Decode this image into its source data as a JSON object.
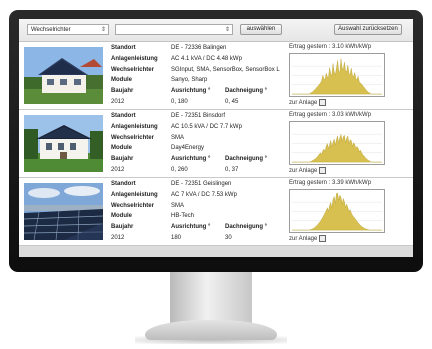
{
  "toolbar": {
    "filter_select": "Wechselrichter",
    "second_select": "",
    "select_button": "auswählen",
    "reset_button": "Auswahl zurücksetzen"
  },
  "labels": {
    "standort": "Standort",
    "anlagenleistung": "Anlagenleistung",
    "wechselrichter": "Wechselrichter",
    "module": "Module",
    "baujahr": "Baujahr",
    "ausrichtung": "Ausrichtung °",
    "dachneigung": "Dachneigung °",
    "zur_anlage": "zur Anlage"
  },
  "plants": [
    {
      "standort": "DE - 72336 Balingen",
      "leistung": "AC 4.1 kVA / DC 4.48 kWp",
      "wechselrichter": "SGInput, SMA, SensorBox, SensorBox L",
      "module": "Sanyo, Sharp",
      "baujahr": "2012",
      "ausrichtung": "0, 180",
      "dachneigung": "0, 45",
      "ertrag": "Ertrag gestern : 3.10 kWh/kWp",
      "chart": [
        0,
        0,
        0,
        0,
        0,
        0,
        0,
        0,
        0,
        0,
        0,
        0,
        0,
        0,
        0,
        0,
        0.02,
        0.04,
        0.06,
        0.09,
        0.12,
        0.15,
        0.19,
        0.22,
        0.26,
        0.3,
        0.35,
        0.5,
        0.42,
        0.38,
        0.56,
        0.47,
        0.44,
        0.71,
        0.55,
        0.49,
        0.82,
        0.6,
        0.52,
        0.69,
        0.9,
        0.62,
        0.58,
        0.95,
        0.7,
        0.66,
        0.86,
        0.62,
        0.6,
        0.78,
        0.55,
        0.52,
        0.7,
        0.5,
        0.46,
        0.58,
        0.42,
        0.38,
        0.48,
        0.33,
        0.3,
        0.27,
        0.23,
        0.19,
        0.15,
        0.11,
        0.08,
        0.05,
        0.03,
        0.01,
        0,
        0,
        0,
        0,
        0,
        0,
        0,
        0,
        0,
        0
      ]
    },
    {
      "standort": "DE - 72351 Binsdorf",
      "leistung": "AC 10.5 kVA / DC 7.7 kWp",
      "wechselrichter": "SMA",
      "module": "Day4Energy",
      "baujahr": "2012",
      "ausrichtung": "0, 260",
      "dachneigung": "0, 37",
      "ertrag": "Ertrag gestern : 3.03 kWh/kWp",
      "chart": [
        0,
        0,
        0,
        0,
        0,
        0,
        0,
        0,
        0,
        0,
        0,
        0,
        0,
        0,
        0,
        0,
        0.01,
        0.02,
        0.04,
        0.06,
        0.08,
        0.1,
        0.13,
        0.17,
        0.21,
        0.25,
        0.2,
        0.3,
        0.35,
        0.28,
        0.42,
        0.5,
        0.36,
        0.46,
        0.58,
        0.41,
        0.53,
        0.62,
        0.45,
        0.6,
        0.7,
        0.5,
        0.66,
        0.74,
        0.56,
        0.68,
        0.72,
        0.52,
        0.64,
        0.7,
        0.48,
        0.6,
        0.58,
        0.42,
        0.52,
        0.48,
        0.36,
        0.42,
        0.38,
        0.28,
        0.32,
        0.26,
        0.2,
        0.17,
        0.13,
        0.1,
        0.07,
        0.05,
        0.03,
        0.01,
        0,
        0,
        0,
        0,
        0,
        0,
        0,
        0,
        0,
        0
      ]
    },
    {
      "standort": "DE - 72351 Geislingen",
      "leistung": "AC 7 kVA / DC 7.53 kWp",
      "wechselrichter": "SMA",
      "module": "HB-Tech",
      "baujahr": "2012",
      "ausrichtung": "180",
      "dachneigung": "30",
      "ertrag": "Ertrag gestern : 3.39 kWh/kWp",
      "chart": [
        0,
        0,
        0,
        0,
        0,
        0,
        0,
        0,
        0,
        0,
        0,
        0,
        0,
        0,
        0,
        0,
        0.01,
        0.02,
        0.03,
        0.05,
        0.07,
        0.1,
        0.13,
        0.16,
        0.2,
        0.24,
        0.29,
        0.34,
        0.4,
        0.46,
        0.52,
        0.6,
        0.5,
        0.66,
        0.74,
        0.6,
        0.82,
        0.9,
        0.72,
        0.98,
        1.0,
        0.8,
        0.94,
        0.88,
        0.7,
        0.85,
        0.76,
        0.6,
        0.7,
        0.6,
        0.5,
        0.55,
        0.46,
        0.4,
        0.36,
        0.32,
        0.28,
        0.24,
        0.2,
        0.16,
        0.13,
        0.1,
        0.08,
        0.06,
        0.04,
        0.03,
        0.02,
        0.01,
        0,
        0,
        0,
        0,
        0,
        0,
        0,
        0,
        0,
        0,
        0,
        0
      ]
    }
  ]
}
